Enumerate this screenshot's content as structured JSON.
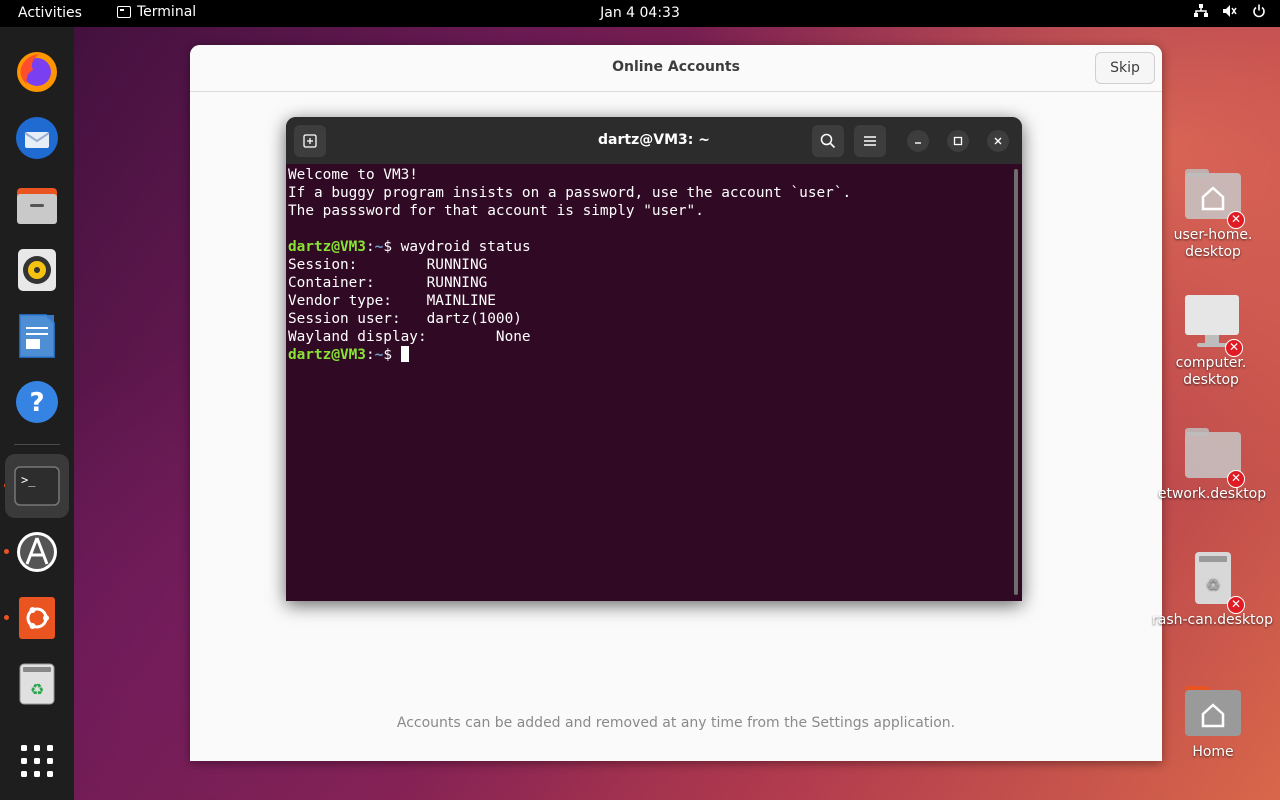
{
  "topbar": {
    "activities": "Activities",
    "app_name": "Terminal",
    "clock": "Jan 4  04:33"
  },
  "dock": {
    "items": [
      {
        "name": "firefox-icon"
      },
      {
        "name": "thunderbird-icon"
      },
      {
        "name": "files-icon"
      },
      {
        "name": "rhythmbox-icon"
      },
      {
        "name": "writer-icon"
      },
      {
        "name": "help-icon"
      },
      {
        "name": "terminal-icon",
        "glyph": ">_"
      },
      {
        "name": "software-icon"
      },
      {
        "name": "ubuntu-icon"
      },
      {
        "name": "trash-icon"
      },
      {
        "name": "app-grid-icon"
      }
    ]
  },
  "accounts": {
    "title": "Online Accounts",
    "skip_label": "Skip",
    "footer_note": "Accounts can be added and removed at any time from the Settings application."
  },
  "terminal": {
    "title": "dartz@VM3: ~",
    "lines": [
      "Welcome to VM3!",
      "If a buggy program insists on a password, use the account `user`.",
      "The passsword for that account is simply \"user\"."
    ],
    "prompt_user": "dartz@VM3",
    "prompt_sep": ":",
    "prompt_path": "~",
    "prompt_symbol": "$ ",
    "command": "waydroid status",
    "output": [
      "Session:        RUNNING",
      "Container:      RUNNING",
      "Vendor type:    MAINLINE",
      "Session user:   dartz(1000)",
      "Wayland display:        None"
    ]
  },
  "desktop": {
    "icons": [
      {
        "label": "user-home.\ndesktop"
      },
      {
        "label": "computer.\ndesktop"
      },
      {
        "label": "etwork.desktop"
      },
      {
        "label": "rash-can.desktop"
      },
      {
        "label": "Home"
      }
    ]
  },
  "colors": {
    "accent": "#e95420",
    "terminal_bg": "#300a24",
    "prompt_user": "#8ae234",
    "prompt_path": "#729fcf"
  }
}
